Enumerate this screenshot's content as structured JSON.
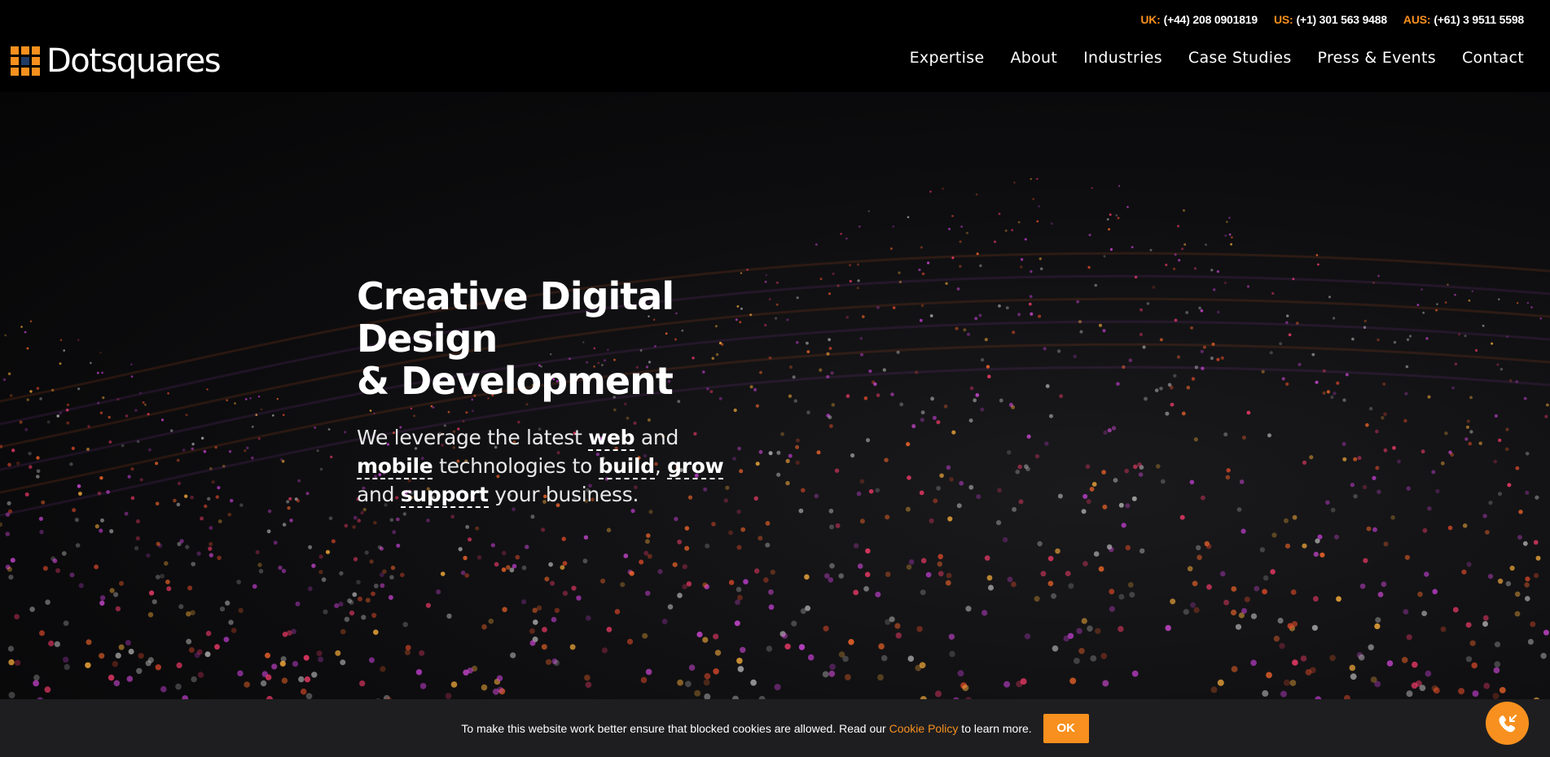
{
  "contact_bar": [
    {
      "label": "UK:",
      "number": "(+44) 208 0901819"
    },
    {
      "label": "US:",
      "number": "(+1) 301 563 9488"
    },
    {
      "label": "AUS:",
      "number": "(+61) 3 9511 5598"
    }
  ],
  "logo": {
    "text": "Dotsquares"
  },
  "nav": [
    "Expertise",
    "About",
    "Industries",
    "Case Studies",
    "Press & Events",
    "Contact"
  ],
  "hero": {
    "title_line1": "Creative Digital Design",
    "title_line2": "& Development",
    "lead": {
      "t1": "We leverage the latest ",
      "web": "web",
      "t2": " and ",
      "mobile": "mobile",
      "t3": " technologies to ",
      "build": "build",
      "t4": ", ",
      "grow": "grow",
      "t5": " and ",
      "support": "support",
      "t6": " your business."
    }
  },
  "cookie": {
    "text_before": "To make this website work better ensure that blocked cookies are allowed. Read our ",
    "link": "Cookie Policy",
    "text_after": " to learn more.",
    "ok_label": "OK"
  },
  "colors": {
    "accent": "#f7901e",
    "background": "#000000",
    "cookie_bar": "#1e1e21"
  },
  "icons": {
    "fab": "phone-call-icon"
  }
}
